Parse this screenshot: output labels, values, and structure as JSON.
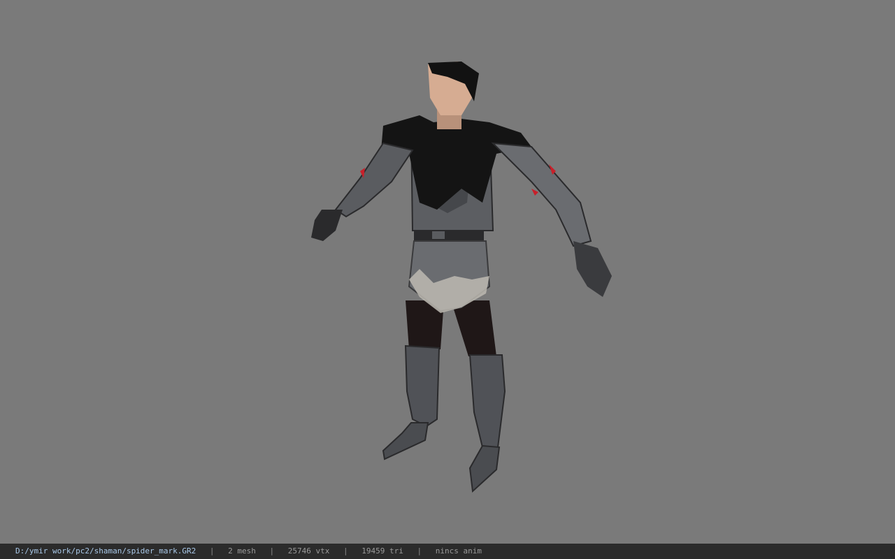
{
  "viewer": {
    "background_color": "#7a7a7a",
    "statusbar_color": "#2b2b2b",
    "path_color": "#a9c8e8",
    "model_icon": "character-model-icon"
  },
  "statusbar": {
    "file_path": "D:/ymir work/pc2/shaman/spider_mark.GR2",
    "separator": "|",
    "mesh_count": "2 mesh",
    "vertex_count": "25746 vtx",
    "triangle_count": "19459 tri",
    "anim_status": "nincs anim"
  }
}
